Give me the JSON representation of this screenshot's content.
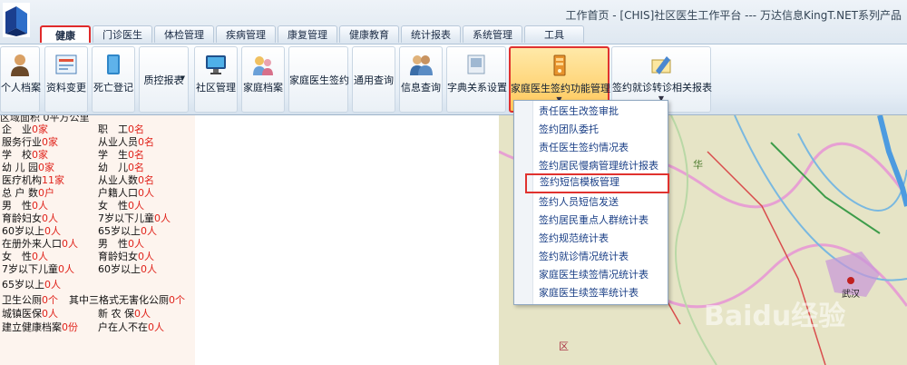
{
  "header": {
    "title": "工作首页 - [CHIS]社区医生工作平台  --- 万达信息KingT.NET系列产品"
  },
  "tabs": [
    {
      "label": "健康档案",
      "active": true
    },
    {
      "label": "门诊医生"
    },
    {
      "label": "体检管理"
    },
    {
      "label": "疾病管理"
    },
    {
      "label": "康复管理"
    },
    {
      "label": "健康教育"
    },
    {
      "label": "统计报表"
    },
    {
      "label": "系统管理"
    },
    {
      "label": "工具"
    }
  ],
  "toolbar": {
    "personal_record": "个人档案",
    "data_change": "资料变更",
    "death_register": "死亡登记",
    "qc_report": "质控报表",
    "community_mgmt": "社区管理",
    "family_record": "家庭档案",
    "family_doctor_sign": "家庭医生签约",
    "general_query": "通用查询",
    "info_query": "信息查询",
    "dict_setting": "字典关系设置",
    "family_doctor_func": "家庭医生签约功能管理",
    "referral_report": "签约就诊转诊相关报表"
  },
  "panel": {
    "cut_row": "区域面积 0平方公里",
    "rows": [
      {
        "l": "企　业",
        "v": "0家",
        "r": "职　工",
        "rv": "0名"
      },
      {
        "l": "服务行业",
        "v": "0家",
        "r": "从业人员",
        "rv": "0名"
      },
      {
        "l": "学　校",
        "v": "0家",
        "r": "学　生",
        "rv": "0名"
      },
      {
        "l": "幼 儿 园",
        "v": "0家",
        "r": "幼　儿",
        "rv": "0名"
      },
      {
        "l": "医疗机构",
        "v": "11家",
        "r": "从业人数",
        "rv": "0名"
      },
      {
        "l": "总 户 数",
        "v": "0户",
        "r": "户籍人口",
        "rv": "0人"
      },
      {
        "l": "男　性",
        "v": "0人",
        "r": "女　性",
        "rv": "0人"
      },
      {
        "l": "育龄妇女",
        "v": "0人",
        "r": "7岁以下儿童",
        "rv": "0人"
      },
      {
        "l": "60岁以上",
        "v": "0人",
        "r": "65岁以上",
        "rv": "0人"
      },
      {
        "l": "在册外来人口",
        "v": "0人",
        "r": "男　性",
        "rv": "0人"
      },
      {
        "l": "女　性",
        "v": "0人",
        "r": "育龄妇女",
        "rv": "0人"
      },
      {
        "l": "7岁以下儿童",
        "v": "0人",
        "r": "60岁以上",
        "rv": "0人"
      },
      {
        "l": "65岁以上",
        "v": "0人"
      },
      {
        "l": "卫生公厕",
        "v": "0个",
        "r": "其中三格式无害化公厕",
        "rv": "0个"
      },
      {
        "l": "城镇医保",
        "v": "0人",
        "r": "新 农 保",
        "rv": "0人"
      },
      {
        "l": "建立健康档案",
        "v": "0份",
        "r": "户在人不在",
        "rv": "0人"
      }
    ]
  },
  "dropdown": {
    "items": [
      "责任医生改签审批",
      "签约团队委托",
      "责任医生签约情况表",
      "签约居民慢病管理统计报表",
      "签约短信模板管理",
      "签约人员短信发送",
      "签约居民重点人群统计表",
      "签约规范统计表",
      "签约就诊情况统计表",
      "家庭医生续签情况统计表",
      "家庭医生续签率统计表"
    ]
  },
  "map": {
    "label_hua": "华",
    "label_qu": "区",
    "label_wuhan": "武汉",
    "watermark": "Baidu经验"
  }
}
